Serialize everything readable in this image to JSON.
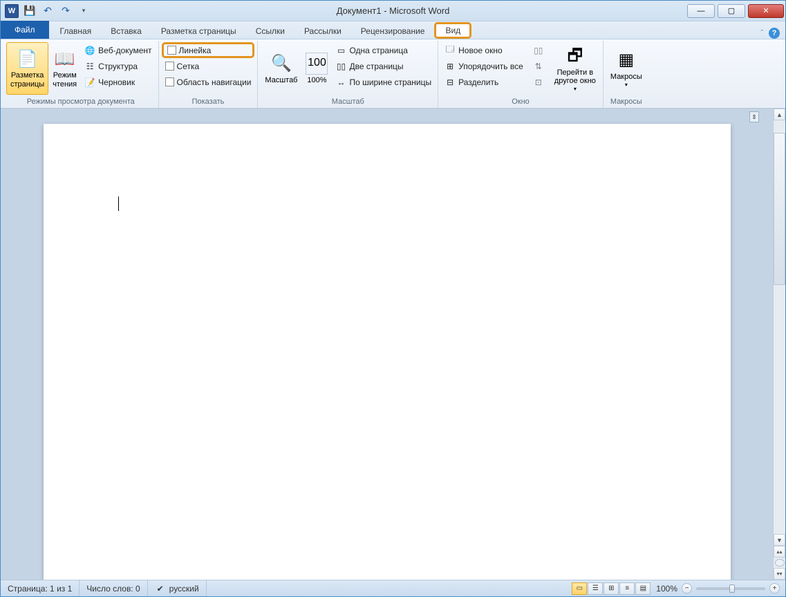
{
  "title": "Документ1 - Microsoft Word",
  "qat": {
    "word": "W"
  },
  "tabs": {
    "file": "Файл",
    "home": "Главная",
    "insert": "Вставка",
    "page_layout": "Разметка страницы",
    "references": "Ссылки",
    "mailings": "Рассылки",
    "review": "Рецензирование",
    "view": "Вид"
  },
  "ribbon": {
    "views_group": {
      "label": "Режимы просмотра документа",
      "print_layout": "Разметка\nстраницы",
      "reading": "Режим\nчтения",
      "web": "Веб-документ",
      "outline": "Структура",
      "draft": "Черновик"
    },
    "show_group": {
      "label": "Показать",
      "ruler": "Линейка",
      "gridlines": "Сетка",
      "nav_pane": "Область навигации"
    },
    "zoom_group": {
      "label": "Масштаб",
      "zoom": "Масштаб",
      "hundred": "100%",
      "one_page": "Одна страница",
      "two_pages": "Две страницы",
      "page_width": "По ширине страницы"
    },
    "window_group": {
      "label": "Окно",
      "new_window": "Новое окно",
      "arrange_all": "Упорядочить все",
      "split": "Разделить",
      "switch": "Перейти в\nдругое окно"
    },
    "macros_group": {
      "label": "Макросы",
      "macros": "Макросы"
    }
  },
  "status": {
    "page": "Страница: 1 из 1",
    "words": "Число слов: 0",
    "language": "русский",
    "zoom": "100%"
  }
}
